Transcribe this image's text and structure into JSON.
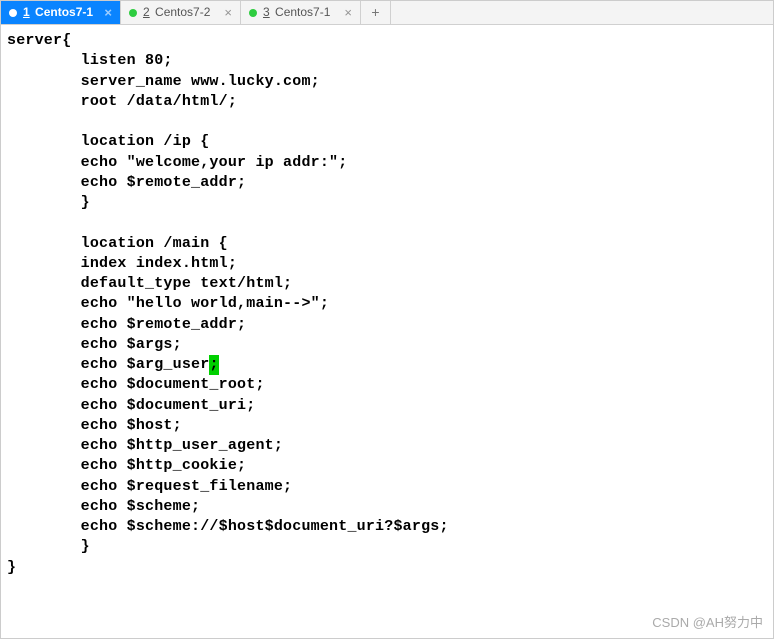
{
  "tabs": [
    {
      "num": "1",
      "name": "Centos7-1",
      "active": true
    },
    {
      "num": "2",
      "name": "Centos7-2",
      "active": false
    },
    {
      "num": "3",
      "name": "Centos7-1",
      "active": false
    }
  ],
  "add_tab_label": "+",
  "code_lines": [
    "server{",
    "        listen 80;",
    "        server_name www.lucky.com;",
    "        root /data/html/;",
    "",
    "        location /ip {",
    "        echo \"welcome,your ip addr:\";",
    "        echo $remote_addr;",
    "        }",
    "",
    "        location /main {",
    "        index index.html;",
    "        default_type text/html;",
    "        echo \"hello world,main-->\";",
    "        echo $remote_addr;",
    "        echo $args;",
    "        echo $arg_user",
    "        echo $document_root;",
    "        echo $document_uri;",
    "        echo $host;",
    "        echo $http_user_agent;",
    "        echo $http_cookie;",
    "        echo $request_filename;",
    "        echo $scheme;",
    "        echo $scheme://$host$document_uri?$args;",
    "        }",
    "}"
  ],
  "cursor_line_index": 16,
  "cursor_char": ";",
  "watermark": "CSDN @AH努力中"
}
